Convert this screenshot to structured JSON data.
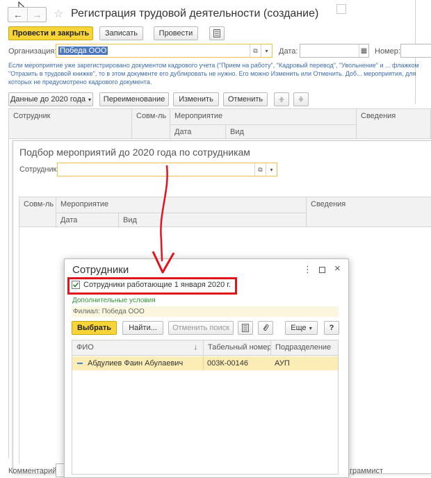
{
  "main": {
    "title": "Регистрация трудовой деятельности (создание)",
    "toolbar": {
      "post_close": "Провести и закрыть",
      "write": "Записать",
      "post": "Провести"
    },
    "org_label": "Организация:",
    "org_value": "Победа ООО",
    "date_label": "Дата:",
    "number_label": "Номер:",
    "info": "Если мероприятие уже зарегистрировано документом кадрового учета (\"Прием на работу\", \"Кадровый перевод\", \"Увольнение\" и ... флажком \"Отразить в трудовой книжке\", то в этом документе его дублировать не нужно. Его можно Изменить или Отменить. Доб... мероприятия, для которых не предусмотрено кадрового документа.",
    "actions": {
      "data_2020": "Данные до 2020 года",
      "rename": "Переименование",
      "change": "Изменить",
      "cancel": "Отменить"
    },
    "table_headers": {
      "employee": "Сотрудник",
      "combo": "Совм-ль",
      "event": "Мероприятие",
      "date": "Дата",
      "kind": "Вид",
      "info": "Сведения"
    },
    "comment_label": "Комментарий:",
    "bottom_right": "граммист"
  },
  "picker": {
    "title": "Подбор мероприятий до 2020 года по сотрудникам",
    "employee_label": "Сотрудник:",
    "table_headers": {
      "combo": "Совм-ль",
      "event": "Мероприятие",
      "date": "Дата",
      "kind": "Вид",
      "info": "Сведения"
    }
  },
  "dialog": {
    "title": "Сотрудники",
    "checkbox_label": "Сотрудники работающие 1 января 2020 г.",
    "checkbox_checked": true,
    "extra_conditions": "Дополнительные условия",
    "branch": "Филиал: Победа ООО",
    "toolbar": {
      "select": "Выбрать",
      "find": "Найти...",
      "cancel_search": "Отменить поиск",
      "more": "Еще",
      "help": "?"
    },
    "table_headers": {
      "name": "ФИО",
      "tab_number": "Табельный номер",
      "department": "Подразделение"
    },
    "rows": [
      {
        "name": "Абдулиев Фаин Абулаевич",
        "tab_number": "003К-00146",
        "department": "АУП"
      }
    ]
  },
  "colors": {
    "primary_button": "#f7d539",
    "link_blue": "#3f6bb0",
    "annotation_red": "#e0141b",
    "selected_row": "#fbedb5",
    "green_link": "#339933"
  }
}
